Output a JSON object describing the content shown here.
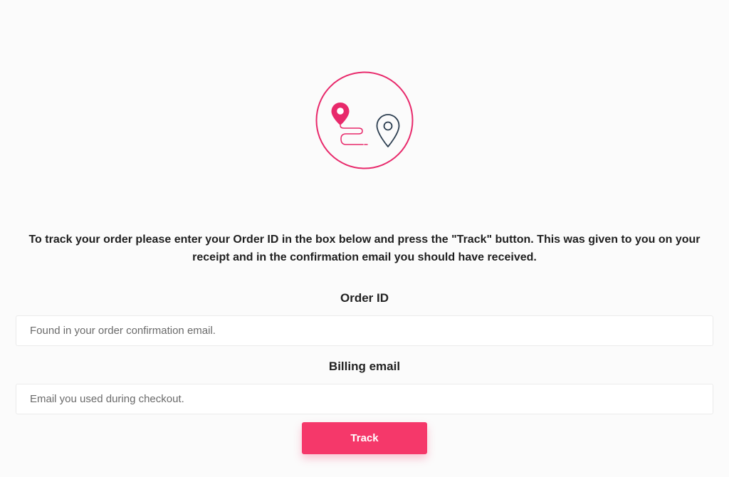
{
  "illustration": {
    "icon": "route-map-pins-icon",
    "accent_color": "#e8296b",
    "secondary_color": "#2c3e50"
  },
  "intro": {
    "text": "To track your order please enter your Order ID in the box below and press the \"Track\" button. This was given to you on your receipt and in the confirmation email you should have received."
  },
  "form": {
    "order_id": {
      "label": "Order ID",
      "value": "",
      "placeholder": "Found in your order confirmation email."
    },
    "billing_email": {
      "label": "Billing email",
      "value": "",
      "placeholder": "Email you used during checkout."
    },
    "submit_label": "Track"
  },
  "colors": {
    "button": "#f5386a",
    "background": "#fbfbfb"
  }
}
